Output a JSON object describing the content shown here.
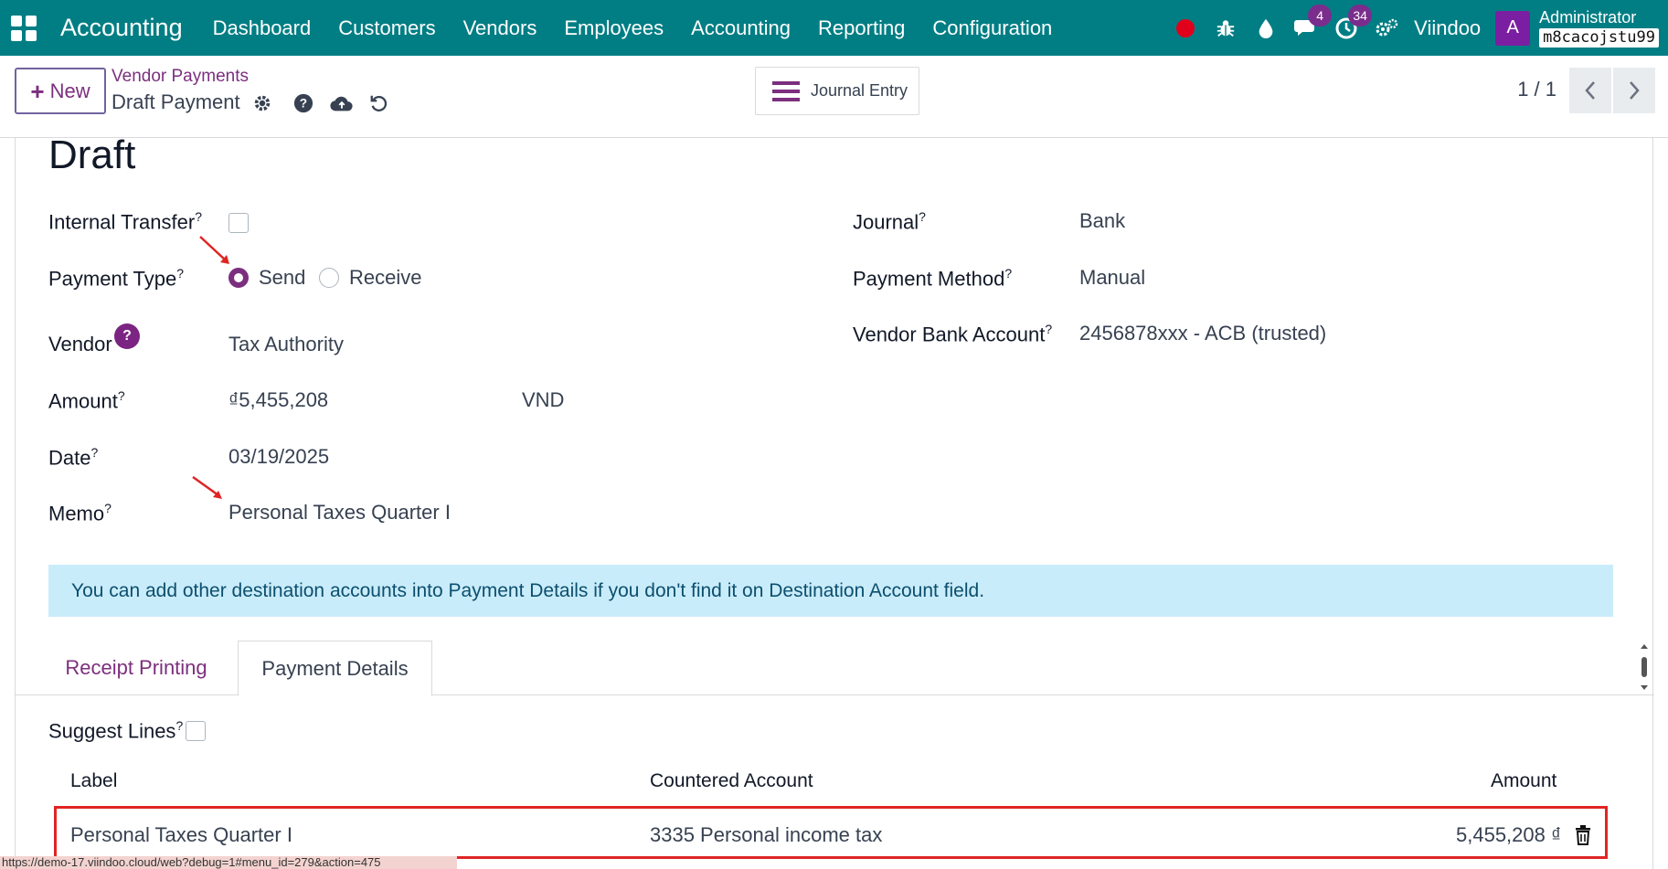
{
  "navbar": {
    "brand": "Accounting",
    "menu": [
      "Dashboard",
      "Customers",
      "Vendors",
      "Employees",
      "Accounting",
      "Reporting",
      "Configuration"
    ],
    "chat_count": "4",
    "activity_count": "34",
    "company": "Viindoo",
    "avatar_letter": "A",
    "user": "Administrator",
    "database": "m8cacojstu99",
    "accent_color": "#017e84"
  },
  "control_panel": {
    "new_button": "New",
    "breadcrumb": "Vendor Payments",
    "record_title": "Draft Payment",
    "smart_button": "Journal Entry",
    "pager": "1 / 1"
  },
  "form": {
    "status": "Draft",
    "internal_transfer_label": "Internal Transfer",
    "payment_type_label": "Payment Type",
    "payment_type_send": "Send",
    "payment_type_receive": "Receive",
    "vendor_label": "Vendor",
    "vendor_value": "Tax Authority",
    "amount_label": "Amount",
    "amount_value": "₫5,455,208",
    "currency": "VND",
    "date_label": "Date",
    "date_value": "03/19/2025",
    "memo_label": "Memo",
    "memo_value": "Personal Taxes Quarter I",
    "journal_label": "Journal",
    "journal_value": "Bank",
    "method_label": "Payment Method",
    "method_value": "Manual",
    "bank_label": "Vendor Bank Account",
    "bank_value": "2456878xxx - ACB (trusted)",
    "help_mark": "?",
    "alert": "You can add other destination accounts into Payment Details if you don't find it on Destination Account field."
  },
  "tabs": {
    "receipt": "Receipt Printing",
    "details": "Payment Details"
  },
  "details": {
    "suggest_label": "Suggest Lines",
    "columns": [
      "Label",
      "Countered Account",
      "Amount"
    ],
    "rows": [
      {
        "label": "Personal Taxes Quarter I",
        "account": "3335 Personal income tax",
        "amount": "5,455,208 ₫"
      }
    ]
  },
  "status_url": "https://demo-17.viindoo.cloud/web?debug=1#menu_id=279&action=475"
}
